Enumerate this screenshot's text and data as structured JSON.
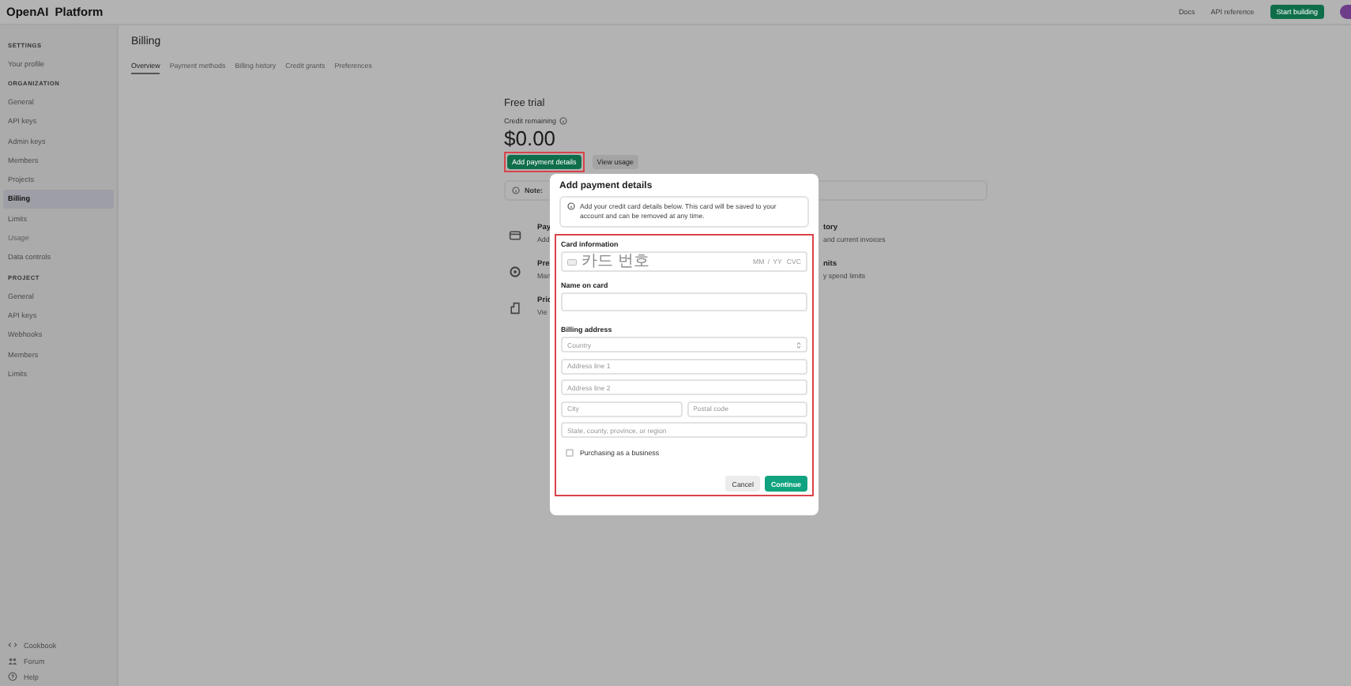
{
  "header": {
    "logo": "OpenAI Platform",
    "links": [
      {
        "label": "Docs",
        "kind": "link"
      },
      {
        "label": "API reference",
        "kind": "link"
      },
      {
        "label": "Start building",
        "kind": "primary"
      }
    ]
  },
  "sidebar": {
    "groups": [
      {
        "heading": "SETTINGS",
        "items": [
          {
            "label": "Your profile",
            "selected": false,
            "disabled": false
          }
        ]
      },
      {
        "heading": "ORGANIZATION",
        "items": [
          {
            "label": "General",
            "selected": false,
            "disabled": false
          },
          {
            "label": "API keys",
            "selected": false,
            "disabled": false
          },
          {
            "label": "Admin keys",
            "selected": false,
            "disabled": false
          },
          {
            "label": "Members",
            "selected": false,
            "disabled": false
          },
          {
            "label": "Projects",
            "selected": false,
            "disabled": false
          },
          {
            "label": "Billing",
            "selected": true,
            "disabled": false
          },
          {
            "label": "Limits",
            "selected": false,
            "disabled": false
          },
          {
            "label": "Usage",
            "selected": false,
            "disabled": true
          },
          {
            "label": "Data controls",
            "selected": false,
            "disabled": false
          }
        ]
      },
      {
        "heading": "PROJECT",
        "items": [
          {
            "label": "General",
            "selected": false,
            "disabled": false
          },
          {
            "label": "API keys",
            "selected": false,
            "disabled": false
          },
          {
            "label": "Webhooks",
            "selected": false,
            "disabled": false
          },
          {
            "label": "Members",
            "selected": false,
            "disabled": false
          },
          {
            "label": "Limits",
            "selected": false,
            "disabled": false
          }
        ]
      }
    ],
    "footer": [
      {
        "label": "Cookbook",
        "kind": "cookbook"
      },
      {
        "label": "Forum",
        "kind": "forum"
      },
      {
        "label": "Help",
        "kind": "help"
      }
    ]
  },
  "page": {
    "title": "Billing",
    "tabs": [
      {
        "label": "Overview",
        "selected": true
      },
      {
        "label": "Payment methods",
        "selected": false
      },
      {
        "label": "Billing history",
        "selected": false
      },
      {
        "label": "Credit grants",
        "selected": false
      },
      {
        "label": "Preferences",
        "selected": false
      }
    ],
    "plan": "Free trial",
    "credit_label": "Credit remaining",
    "credit": "$0.00",
    "actions": [
      {
        "label": "Add payment details",
        "kind": "primary",
        "highlighted": true
      },
      {
        "label": "View usage",
        "kind": "secondary",
        "highlighted": false
      }
    ],
    "note": "Note:",
    "items": [
      {
        "kind": "card",
        "left_title": "Pay",
        "left_text": "Add",
        "right_title": "tory",
        "right_text": "and current invoices"
      },
      {
        "kind": "gear",
        "left_title": "Pre",
        "left_text": "Man",
        "right_title": "nits",
        "right_text": "y spend limits"
      },
      {
        "kind": "tag",
        "left_title": "Pric",
        "left_text": "Vie"
      }
    ]
  },
  "dialog": {
    "title": "Add payment details",
    "info": "Add your credit card details below. This card will be saved to your account and can be removed at any time.",
    "form_highlighted": true,
    "card_label": "Card information",
    "card_placeholder": "카드 번호",
    "card_expiry": "MM / YY",
    "card_cvc": "CVC",
    "name_label": "Name on card",
    "address_label": "Billing address",
    "country_placeholder": "Country",
    "address1_placeholder": "Address line 1",
    "address2_placeholder": "Address line 2",
    "city_placeholder": "City",
    "postal_placeholder": "Postal code",
    "region_placeholder": "State, county, province, or region",
    "business": {
      "label": "Purchasing as a business",
      "checked": false
    },
    "buttons": [
      {
        "label": "Cancel",
        "kind": "secondary"
      },
      {
        "label": "Continue",
        "kind": "primary"
      }
    ]
  }
}
